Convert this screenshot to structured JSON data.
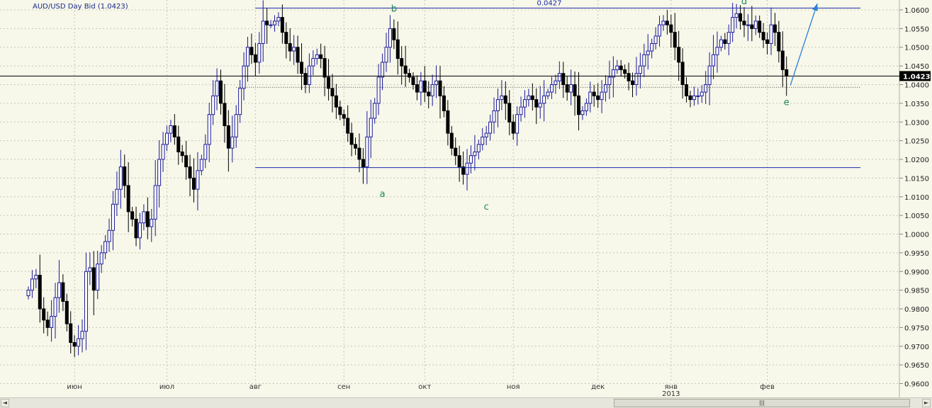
{
  "chart_data": {
    "type": "candlestick",
    "title": "AUD/USD Day Bid (1.0423)",
    "last_price_label": "1.0423",
    "last_price": 1.0423,
    "ylim": [
      0.9565,
      1.0625
    ],
    "y_ticks": [
      "1.0600",
      "1.0550",
      "1.0500",
      "1.0450",
      "1.0400",
      "1.0350",
      "1.0300",
      "1.0250",
      "1.0200",
      "1.0150",
      "1.0100",
      "1.0050",
      "1.0000",
      "0.9950",
      "0.9900",
      "0.9850",
      "0.9800",
      "0.9750",
      "0.9700",
      "0.9650",
      "0.9600"
    ],
    "y_tick_values": [
      1.06,
      1.055,
      1.05,
      1.045,
      1.04,
      1.035,
      1.03,
      1.025,
      1.02,
      1.015,
      1.01,
      1.005,
      1.0,
      0.995,
      0.99,
      0.985,
      0.98,
      0.975,
      0.97,
      0.965,
      0.96
    ],
    "x_ticks": [
      {
        "label": "июн",
        "bar": 12
      },
      {
        "label": "июл",
        "bar": 36
      },
      {
        "label": "авг",
        "bar": 59
      },
      {
        "label": "сен",
        "bar": 82
      },
      {
        "label": "окт",
        "bar": 103
      },
      {
        "label": "ноя",
        "bar": 126
      },
      {
        "label": "дек",
        "bar": 148
      },
      {
        "label": "янв",
        "bar": 167
      },
      {
        "label": "фев",
        "bar": 192
      }
    ],
    "year_label": "2013",
    "year_label_bar": 167,
    "bar_count": 200,
    "closes": [
      0.985,
      0.988,
      0.989,
      0.98,
      0.977,
      0.975,
      0.978,
      0.983,
      0.987,
      0.982,
      0.976,
      0.971,
      0.97,
      0.972,
      0.974,
      0.99,
      0.991,
      0.985,
      0.992,
      0.995,
      0.998,
      1.001,
      1.008,
      1.012,
      1.018,
      1.013,
      1.006,
      1.004,
      0.999,
      1.003,
      1.006,
      1.002,
      1.004,
      1.013,
      1.02,
      1.024,
      1.027,
      1.029,
      1.026,
      1.022,
      1.021,
      1.018,
      1.015,
      1.012,
      1.017,
      1.02,
      1.024,
      1.032,
      1.037,
      1.041,
      1.035,
      1.029,
      1.023,
      1.026,
      1.032,
      1.039,
      1.045,
      1.05,
      1.048,
      1.046,
      1.051,
      1.057,
      1.056,
      1.056,
      1.057,
      1.058,
      1.054,
      1.051,
      1.049,
      1.05,
      1.046,
      1.043,
      1.04,
      1.045,
      1.047,
      1.048,
      1.047,
      1.042,
      1.039,
      1.037,
      1.034,
      1.032,
      1.031,
      1.027,
      1.024,
      1.023,
      1.02,
      1.018,
      1.026,
      1.031,
      1.035,
      1.042,
      1.046,
      1.05,
      1.055,
      1.052,
      1.047,
      1.045,
      1.043,
      1.042,
      1.04,
      1.038,
      1.041,
      1.038,
      1.037,
      1.04,
      1.041,
      1.037,
      1.033,
      1.027,
      1.023,
      1.021,
      1.018,
      1.016,
      1.019,
      1.021,
      1.022,
      1.024,
      1.026,
      1.027,
      1.03,
      1.033,
      1.036,
      1.037,
      1.035,
      1.03,
      1.027,
      1.032,
      1.034,
      1.036,
      1.037,
      1.036,
      1.034,
      1.035,
      1.037,
      1.038,
      1.04,
      1.041,
      1.043,
      1.04,
      1.038,
      1.04,
      1.037,
      1.032,
      1.033,
      1.035,
      1.038,
      1.037,
      1.036,
      1.038,
      1.04,
      1.042,
      1.044,
      1.045,
      1.044,
      1.043,
      1.041,
      1.04,
      1.043,
      1.045,
      1.048,
      1.049,
      1.051,
      1.053,
      1.056,
      1.057,
      1.056,
      1.054,
      1.05,
      1.046,
      1.04,
      1.037,
      1.036,
      1.037,
      1.037,
      1.038,
      1.04,
      1.045,
      1.048,
      1.05,
      1.052,
      1.051,
      1.054,
      1.058,
      1.059,
      1.057,
      1.056,
      1.056,
      1.055,
      1.057,
      1.054,
      1.052,
      1.051,
      1.056,
      1.054,
      1.049,
      1.044,
      1.0423
    ]
  },
  "annotations": {
    "wave_labels": [
      {
        "text": "a",
        "bar": 92,
        "price": 1.01
      },
      {
        "text": "b",
        "bar": 95,
        "price": 1.0595
      },
      {
        "text": "c",
        "bar": 119,
        "price": 1.0065
      },
      {
        "text": "d",
        "bar": 186,
        "price": 1.0615
      },
      {
        "text": "e",
        "bar": 197,
        "price": 1.0345
      }
    ],
    "channel_label": "0.0427",
    "upper_line": {
      "price": 1.0605
    },
    "lower_line": {
      "price": 1.0178
    },
    "dotted_level": 1.0393,
    "arrow": {
      "from_bar": 198,
      "from_price": 1.0398,
      "to_bar": 205,
      "to_price": 1.0617
    }
  },
  "colors": {
    "background": "#f7f7ea",
    "grid": "#c8c8b4",
    "up_candle_fill": "#ffffff",
    "up_candle_stroke": "#1a1a9a",
    "down_candle": "#000000",
    "trend_lines": "#1a2aa8",
    "arrow": "#2a7fd8",
    "wave_labels": "#1f8a5a",
    "price_box": "#000000",
    "price_box_text": "#ffffff"
  },
  "scrollbar": {
    "thumb_glyph": "|||",
    "left_glyph": "◄",
    "right_glyph": "►"
  }
}
